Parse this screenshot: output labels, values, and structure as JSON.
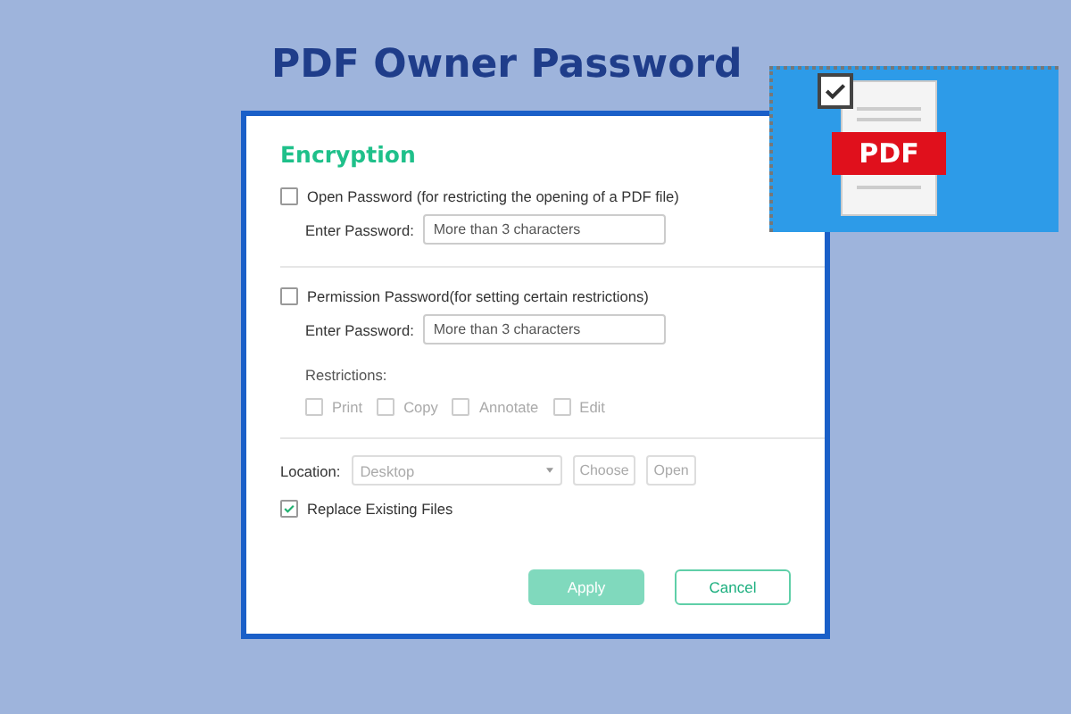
{
  "header": {
    "title": "PDF Owner Password",
    "icon_label": "PDF",
    "icon_checked": true
  },
  "dialog": {
    "section_title": "Encryption",
    "open_password": {
      "label": "Open Password (for restricting the opening of a PDF file)",
      "checked": false,
      "field_label": "Enter Password:",
      "placeholder": "More than 3 characters"
    },
    "permission_password": {
      "label": "Permission Password(for setting certain restrictions)",
      "checked": false,
      "field_label": "Enter Password:",
      "placeholder": "More than 3 characters"
    },
    "restrictions_label": "Restrictions:",
    "restrictions": [
      {
        "label": "Print",
        "checked": false,
        "disabled": true
      },
      {
        "label": "Copy",
        "checked": false,
        "disabled": true
      },
      {
        "label": "Annotate",
        "checked": false,
        "disabled": true
      },
      {
        "label": "Edit",
        "checked": false,
        "disabled": true
      }
    ],
    "location": {
      "label": "Location:",
      "value": "Desktop",
      "disabled": true
    },
    "location_buttons": [
      {
        "label": "Choose",
        "disabled": true
      },
      {
        "label": "Open",
        "disabled": true
      }
    ],
    "replace_existing": {
      "label": "Replace Existing Files",
      "checked": true
    },
    "buttons": [
      {
        "label": "Apply",
        "kind": "primary",
        "disabled": true
      },
      {
        "label": "Cancel",
        "kind": "secondary",
        "disabled": false
      }
    ]
  }
}
